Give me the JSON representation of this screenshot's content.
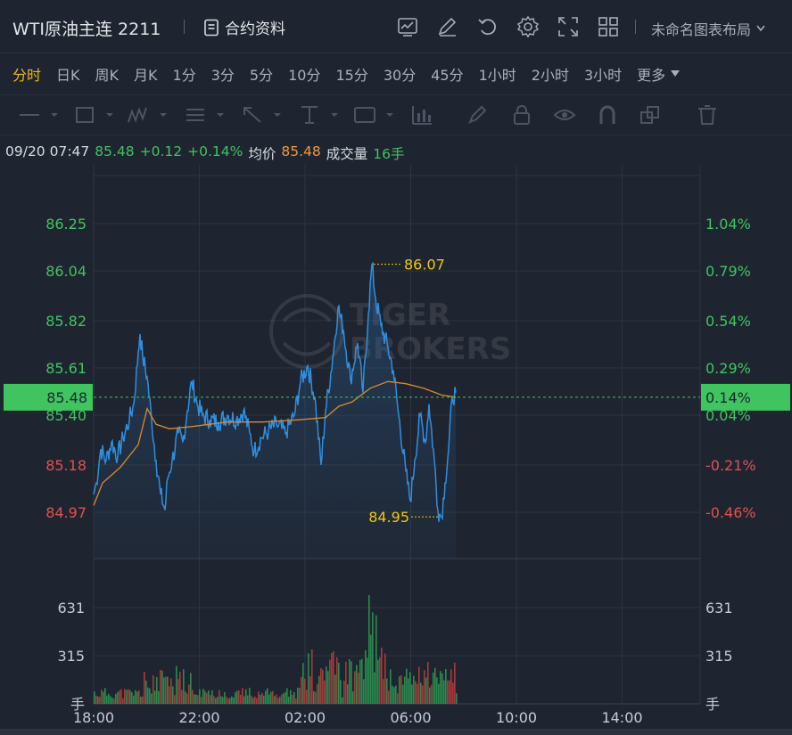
{
  "header": {
    "symbol": "WTI原油主连 2211",
    "contract_label": "合约资料",
    "layout_label": "未命名图表布局",
    "tool_icons": [
      "chart-template-icon",
      "edit-icon",
      "undo-icon",
      "settings-icon",
      "fullscreen-icon",
      "grid-layout-icon"
    ]
  },
  "periods": [
    {
      "label": "分时",
      "active": true
    },
    {
      "label": "日K"
    },
    {
      "label": "周K"
    },
    {
      "label": "月K"
    },
    {
      "label": "1分"
    },
    {
      "label": "3分"
    },
    {
      "label": "5分"
    },
    {
      "label": "10分"
    },
    {
      "label": "15分"
    },
    {
      "label": "30分"
    },
    {
      "label": "45分"
    },
    {
      "label": "1小时"
    },
    {
      "label": "2小时"
    },
    {
      "label": "3小时"
    }
  ],
  "more_label": "更多",
  "drawing_tools": [
    "line-tool-icon",
    "rectangle-tool-icon",
    "pattern-tool-icon",
    "text-list-tool-icon",
    "arrow-tool-icon",
    "measure-tool-icon",
    "label-tool-icon",
    "indicator-tool-icon",
    "brush-icon",
    "lock-icon",
    "eye-icon",
    "magnet-icon",
    "clone-icon",
    "trash-icon"
  ],
  "info": {
    "datetime": "09/20 07:47",
    "price": "85.48",
    "change": "+0.12",
    "change_pct": "+0.14%",
    "avg_label": "均价",
    "avg_price": "85.48",
    "volume_label": "成交量",
    "volume": "16手"
  },
  "watermark": [
    "TIGER",
    "BROKERS"
  ],
  "chart_data": {
    "type": "line",
    "time_labels": [
      "18:00",
      "22:00",
      "02:00",
      "06:00",
      "10:00",
      "14:00"
    ],
    "price_ticks": [
      {
        "price": 86.25,
        "pct": "1.04%",
        "color": "up"
      },
      {
        "price": 86.04,
        "pct": "0.79%",
        "color": "up"
      },
      {
        "price": 85.82,
        "pct": "0.54%",
        "color": "up"
      },
      {
        "price": 85.61,
        "pct": "0.29%",
        "color": "up"
      },
      {
        "price": 85.4,
        "pct": "0.04%",
        "color": "up"
      },
      {
        "price": 85.18,
        "pct": "-0.21%",
        "color": "down"
      },
      {
        "price": 84.97,
        "pct": "-0.46%",
        "color": "down"
      }
    ],
    "current": {
      "price": "85.48",
      "pct": "0.14%"
    },
    "high_label": "86.07",
    "low_label": "84.95",
    "volume_ticks": [
      "631",
      "315"
    ],
    "volume_unit": "手",
    "series": [
      {
        "name": "price",
        "points": [
          [
            0,
            85.05
          ],
          [
            3,
            85.1
          ],
          [
            8,
            85.25
          ],
          [
            14,
            85.2
          ],
          [
            20,
            85.28
          ],
          [
            27,
            85.22
          ],
          [
            33,
            85.3
          ],
          [
            40,
            85.38
          ],
          [
            45,
            85.45
          ],
          [
            50,
            85.68
          ],
          [
            52,
            85.76
          ],
          [
            55,
            85.66
          ],
          [
            60,
            85.57
          ],
          [
            65,
            85.38
          ],
          [
            70,
            85.2
          ],
          [
            75,
            85.05
          ],
          [
            80,
            84.98
          ],
          [
            83,
            85.12
          ],
          [
            88,
            85.2
          ],
          [
            95,
            85.32
          ],
          [
            100,
            85.28
          ],
          [
            105,
            85.42
          ],
          [
            110,
            85.55
          ],
          [
            116,
            85.45
          ],
          [
            122,
            85.4
          ],
          [
            130,
            85.38
          ],
          [
            140,
            85.37
          ],
          [
            150,
            85.4
          ],
          [
            160,
            85.38
          ],
          [
            168,
            85.42
          ],
          [
            175,
            85.32
          ],
          [
            180,
            85.24
          ],
          [
            188,
            85.3
          ],
          [
            196,
            85.33
          ],
          [
            205,
            85.36
          ],
          [
            215,
            85.32
          ],
          [
            225,
            85.4
          ],
          [
            232,
            85.55
          ],
          [
            240,
            85.62
          ],
          [
            248,
            85.48
          ],
          [
            255,
            85.18
          ],
          [
            260,
            85.42
          ],
          [
            268,
            85.65
          ],
          [
            274,
            85.88
          ],
          [
            280,
            85.78
          ],
          [
            288,
            85.56
          ],
          [
            296,
            85.72
          ],
          [
            302,
            85.5
          ],
          [
            308,
            85.85
          ],
          [
            312,
            86.07
          ],
          [
            316,
            85.92
          ],
          [
            322,
            85.8
          ],
          [
            330,
            85.7
          ],
          [
            336,
            85.6
          ],
          [
            342,
            85.4
          ],
          [
            350,
            85.15
          ],
          [
            355,
            85.02
          ],
          [
            360,
            85.2
          ],
          [
            366,
            85.4
          ],
          [
            372,
            85.28
          ],
          [
            376,
            85.45
          ],
          [
            382,
            85.2
          ],
          [
            386,
            84.98
          ],
          [
            390,
            84.95
          ],
          [
            394,
            85.1
          ],
          [
            398,
            85.25
          ],
          [
            402,
            85.48
          ],
          [
            406,
            85.5
          ]
        ]
      },
      {
        "name": "avg",
        "points": [
          [
            0,
            85.0
          ],
          [
            10,
            85.1
          ],
          [
            30,
            85.17
          ],
          [
            50,
            85.27
          ],
          [
            60,
            85.43
          ],
          [
            70,
            85.36
          ],
          [
            85,
            85.34
          ],
          [
            110,
            85.35
          ],
          [
            150,
            85.37
          ],
          [
            190,
            85.37
          ],
          [
            230,
            85.38
          ],
          [
            260,
            85.39
          ],
          [
            275,
            85.44
          ],
          [
            290,
            85.46
          ],
          [
            310,
            85.52
          ],
          [
            330,
            85.55
          ],
          [
            350,
            85.54
          ],
          [
            370,
            85.52
          ],
          [
            390,
            85.49
          ],
          [
            406,
            85.48
          ]
        ]
      }
    ],
    "volume_max_tick": 631
  }
}
